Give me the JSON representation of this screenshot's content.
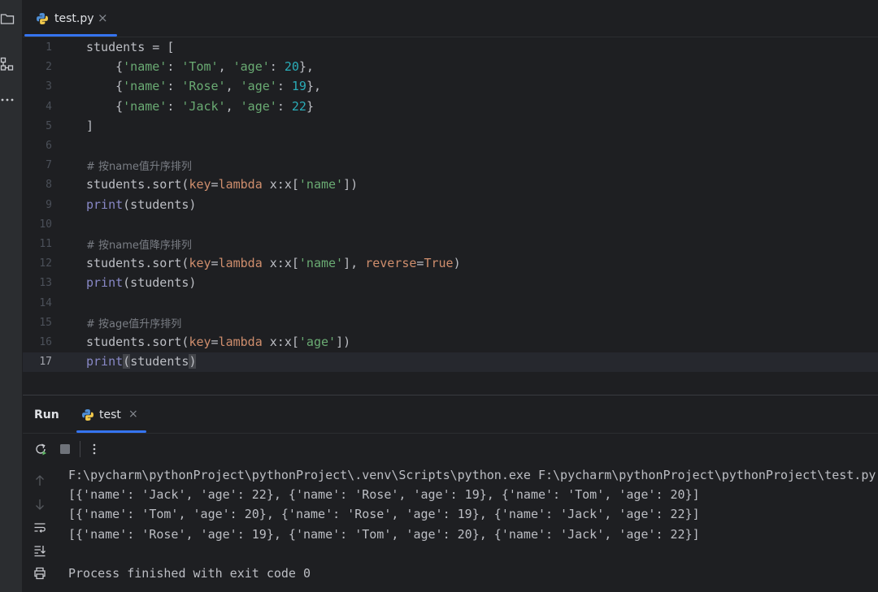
{
  "editor_tab": {
    "label": "test.py",
    "close": "×"
  },
  "code_lines": [
    {
      "n": "1",
      "tokens": [
        {
          "t": "students = ["
        }
      ]
    },
    {
      "n": "2",
      "tokens": [
        {
          "t": "    {"
        },
        {
          "t": "'name'",
          "c": "str"
        },
        {
          "t": ": "
        },
        {
          "t": "'Tom'",
          "c": "str"
        },
        {
          "t": ", "
        },
        {
          "t": "'age'",
          "c": "str"
        },
        {
          "t": ": "
        },
        {
          "t": "20",
          "c": "num"
        },
        {
          "t": "},"
        }
      ]
    },
    {
      "n": "3",
      "tokens": [
        {
          "t": "    {"
        },
        {
          "t": "'name'",
          "c": "str"
        },
        {
          "t": ": "
        },
        {
          "t": "'Rose'",
          "c": "str"
        },
        {
          "t": ", "
        },
        {
          "t": "'age'",
          "c": "str"
        },
        {
          "t": ": "
        },
        {
          "t": "19",
          "c": "num"
        },
        {
          "t": "},"
        }
      ]
    },
    {
      "n": "4",
      "tokens": [
        {
          "t": "    {"
        },
        {
          "t": "'name'",
          "c": "str"
        },
        {
          "t": ": "
        },
        {
          "t": "'Jack'",
          "c": "str"
        },
        {
          "t": ", "
        },
        {
          "t": "'age'",
          "c": "str"
        },
        {
          "t": ": "
        },
        {
          "t": "22",
          "c": "num"
        },
        {
          "t": "}"
        }
      ]
    },
    {
      "n": "5",
      "tokens": [
        {
          "t": "]"
        }
      ]
    },
    {
      "n": "6",
      "tokens": []
    },
    {
      "n": "7",
      "tokens": [
        {
          "t": "# 按name值升序排列",
          "c": "com"
        }
      ]
    },
    {
      "n": "8",
      "tokens": [
        {
          "t": "students.sort("
        },
        {
          "t": "key",
          "c": "param"
        },
        {
          "t": "="
        },
        {
          "t": "lambda",
          "c": "kw"
        },
        {
          "t": " x:x["
        },
        {
          "t": "'name'",
          "c": "str"
        },
        {
          "t": "])"
        }
      ]
    },
    {
      "n": "9",
      "tokens": [
        {
          "t": "print",
          "c": "builtin"
        },
        {
          "t": "(students)"
        }
      ]
    },
    {
      "n": "10",
      "tokens": []
    },
    {
      "n": "11",
      "tokens": [
        {
          "t": "# 按name值降序排列",
          "c": "com"
        }
      ]
    },
    {
      "n": "12",
      "tokens": [
        {
          "t": "students.sort("
        },
        {
          "t": "key",
          "c": "param"
        },
        {
          "t": "="
        },
        {
          "t": "lambda",
          "c": "kw"
        },
        {
          "t": " x:x["
        },
        {
          "t": "'name'",
          "c": "str"
        },
        {
          "t": "], "
        },
        {
          "t": "reverse",
          "c": "param"
        },
        {
          "t": "="
        },
        {
          "t": "True",
          "c": "kw"
        },
        {
          "t": ")"
        }
      ]
    },
    {
      "n": "13",
      "tokens": [
        {
          "t": "print",
          "c": "builtin"
        },
        {
          "t": "(students)"
        }
      ]
    },
    {
      "n": "14",
      "tokens": []
    },
    {
      "n": "15",
      "tokens": [
        {
          "t": "# 按age值升序排列",
          "c": "com"
        }
      ]
    },
    {
      "n": "16",
      "tokens": [
        {
          "t": "students.sort("
        },
        {
          "t": "key",
          "c": "param"
        },
        {
          "t": "="
        },
        {
          "t": "lambda",
          "c": "kw"
        },
        {
          "t": " x:x["
        },
        {
          "t": "'age'",
          "c": "str"
        },
        {
          "t": "])"
        }
      ]
    },
    {
      "n": "17",
      "current": true,
      "tokens": [
        {
          "t": "print",
          "c": "builtin"
        },
        {
          "t": "(",
          "c": "paren"
        },
        {
          "t": "students"
        },
        {
          "t": ")",
          "c": "paren"
        }
      ]
    }
  ],
  "run_panel": {
    "title": "Run",
    "tab_label": "test",
    "tab_close": "×"
  },
  "console_output": [
    "F:\\pycharm\\pythonProject\\pythonProject\\.venv\\Scripts\\python.exe F:\\pycharm\\pythonProject\\pythonProject\\test.py",
    "[{'name': 'Jack', 'age': 22}, {'name': 'Rose', 'age': 19}, {'name': 'Tom', 'age': 20}]",
    "[{'name': 'Tom', 'age': 20}, {'name': 'Rose', 'age': 19}, {'name': 'Jack', 'age': 22}]",
    "[{'name': 'Rose', 'age': 19}, {'name': 'Tom', 'age': 20}, {'name': 'Jack', 'age': 22}]",
    "",
    "Process finished with exit code 0"
  ],
  "icons": {
    "activity_bar": [
      "folder-icon",
      "structure-icon",
      "more-icon"
    ],
    "run_toolbar": [
      "rerun-icon",
      "stop-icon",
      "more-vertical-icon"
    ],
    "console_gutter": [
      "scroll-up-icon",
      "scroll-down-icon",
      "soft-wrap-icon",
      "scroll-to-end-icon",
      "print-icon"
    ]
  },
  "colors": {
    "background": "#1e1f22",
    "accent": "#3574f0",
    "string": "#6aab73",
    "number": "#2aacb8",
    "keyword": "#cf8e6d",
    "builtin": "#8888c6",
    "comment": "#7a7e85"
  }
}
